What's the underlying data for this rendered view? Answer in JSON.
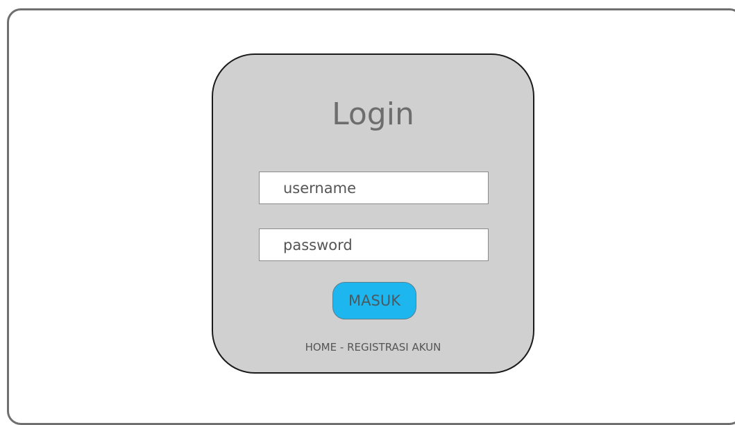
{
  "login": {
    "title": "Login",
    "username_placeholder": "username",
    "password_placeholder": "password",
    "submit_label": "MASUK",
    "links": {
      "home_label": "HOME",
      "separator": " - ",
      "register_label": "REGISTRASI AKUN"
    }
  },
  "colors": {
    "card_background": "#d0d0d0",
    "button_background": "#1eb6ee",
    "frame_border": "#6f6f6f"
  }
}
